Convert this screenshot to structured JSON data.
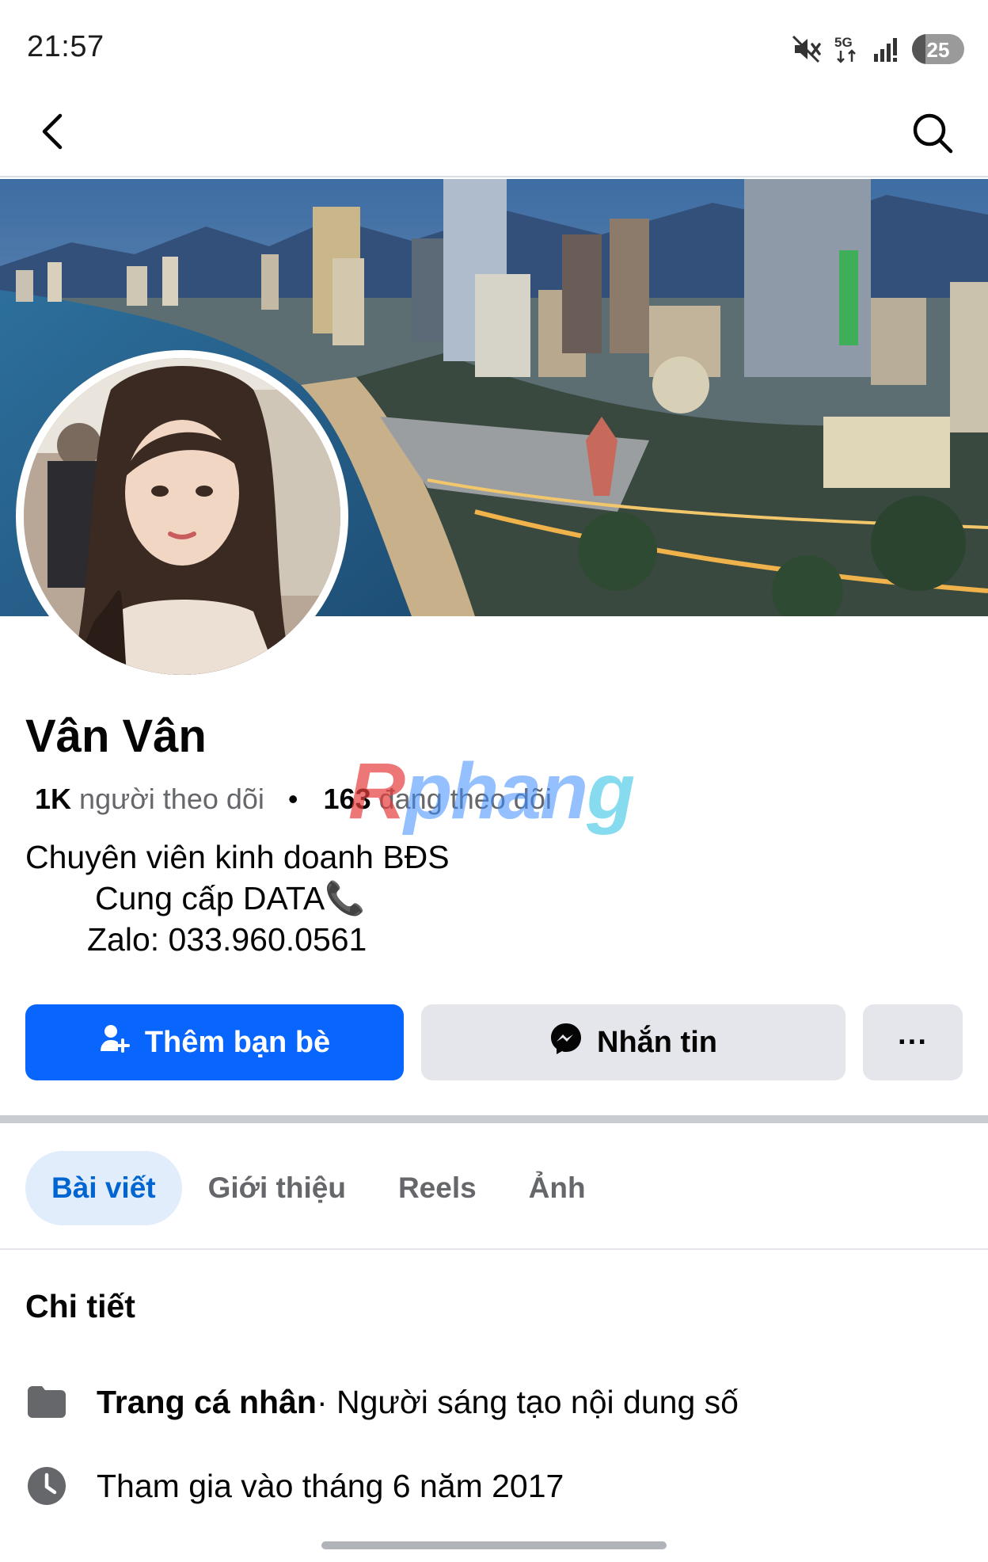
{
  "status_bar": {
    "time": "21:57",
    "network": "5G",
    "battery": "25",
    "battery_level": 0.25,
    "icons": [
      "mute-icon",
      "5g-icon",
      "signal-icon",
      "battery-icon"
    ]
  },
  "nav": {
    "icons": [
      "back-arrow-icon",
      "search-icon"
    ]
  },
  "profile": {
    "name": "Vân Vân",
    "followers_count": "1K",
    "followers_label": "người theo dõi",
    "separator": "•",
    "following_count": "163",
    "following_label": "đang theo dõi",
    "bio_line_1": "Chuyên viên kinh doanh BĐS",
    "bio_line_2": "Cung cấp DATA📞",
    "bio_line_3": "Zalo: 033.960.0561"
  },
  "watermark": {
    "part_1": "R",
    "part_2": "phan",
    "part_3": "g"
  },
  "actions": {
    "add_friend_label": "Thêm bạn bè",
    "message_label": "Nhắn tin",
    "more_label": "···"
  },
  "tabs": [
    {
      "label": "Bài viết",
      "active": true
    },
    {
      "label": "Giới thiệu",
      "active": false
    },
    {
      "label": "Reels",
      "active": false
    },
    {
      "label": "Ảnh",
      "active": false
    }
  ],
  "details": {
    "title": "Chi tiết",
    "page_type_bold": "Trang cá nhân",
    "page_type_rest": " · Người sáng tạo nội dung số",
    "joined": "Tham gia vào tháng 6 năm 2017"
  },
  "colors": {
    "primary_blue": "#0866ff",
    "secondary_gray": "#e4e6eb",
    "active_tab_bg": "#e2edfc",
    "active_tab_text": "#0064d1",
    "muted_text": "#65676b"
  }
}
